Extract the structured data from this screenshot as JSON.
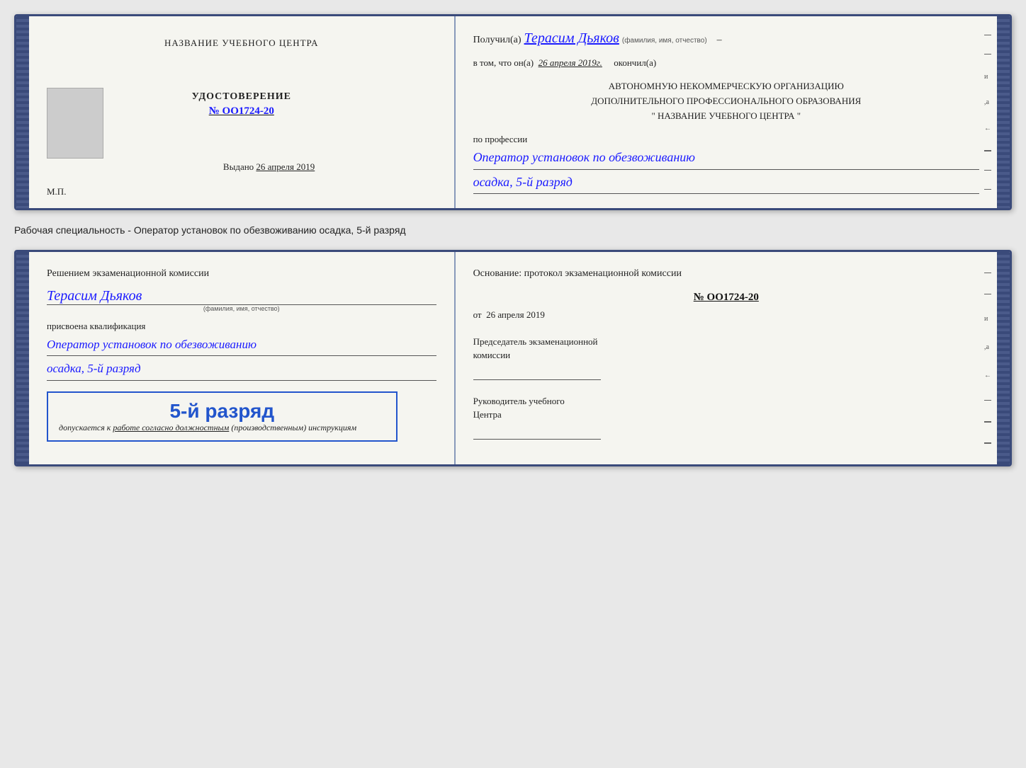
{
  "top_card": {
    "left": {
      "center_title": "НАЗВАНИЕ УЧЕБНОГО ЦЕНТРА",
      "udostoverenie": "УДОСТОВЕРЕНИЕ",
      "number": "№ OO1724-20",
      "vydano_label": "Выдано",
      "vydano_date": "26 апреля 2019",
      "mp_label": "М.П."
    },
    "right": {
      "poluchil_prefix": "Получил(а)",
      "name_handwritten": "Терасим Дьяков",
      "fio_label": "(фамилия, имя, отчество)",
      "dash": "–",
      "vtom_prefix": "в том, что он(а)",
      "vtom_date": "26 апреля 2019г.",
      "okonchil": "окончил(а)",
      "auto_line1": "АВТОНОМНУЮ НЕКОММЕРЧЕСКУЮ ОРГАНИЗАЦИЮ",
      "auto_line2": "ДОПОЛНИТЕЛЬНОГО ПРОФЕССИОНАЛЬНОГО ОБРАЗОВАНИЯ",
      "auto_line3": "\"   НАЗВАНИЕ УЧЕБНОГО ЦЕНТРА   \"",
      "po_professii": "по профессии",
      "profession1": "Оператор установок по обезвоживанию",
      "profession2": "осадка, 5-й разряд"
    }
  },
  "caption": "Рабочая специальность - Оператор установок по обезвоживанию осадка, 5-й разряд",
  "bottom_card": {
    "left": {
      "resheniye": "Решением экзаменационной комиссии",
      "name_handwritten": "Терасим Дьяков",
      "fio_label": "(фамилия, имя, отчество)",
      "prisvoena": "присвоена квалификация",
      "kvalif1": "Оператор установок по обезвоживанию",
      "kvalif2": "осадка, 5-й разряд",
      "stamp_number": "5-й разряд",
      "dopusk_prefix": "допускается к",
      "dopusk_underline": "работе согласно должностным",
      "dopusk_suffix": "(производственным) инструкциям"
    },
    "right": {
      "osnovanie": "Основание: протокол экзаменационной комиссии",
      "proto_number": "№ OO1724-20",
      "ot_prefix": "от",
      "ot_date": "26 апреля 2019",
      "predsedatel_line1": "Председатель экзаменационной",
      "predsedatel_line2": "комиссии",
      "rukovoditel_line1": "Руководитель учебного",
      "rukovoditel_line2": "Центра"
    }
  },
  "edge_marks": [
    "–",
    "–",
    "–",
    "и",
    ",а",
    "←",
    "–",
    "–",
    "–",
    "–"
  ]
}
